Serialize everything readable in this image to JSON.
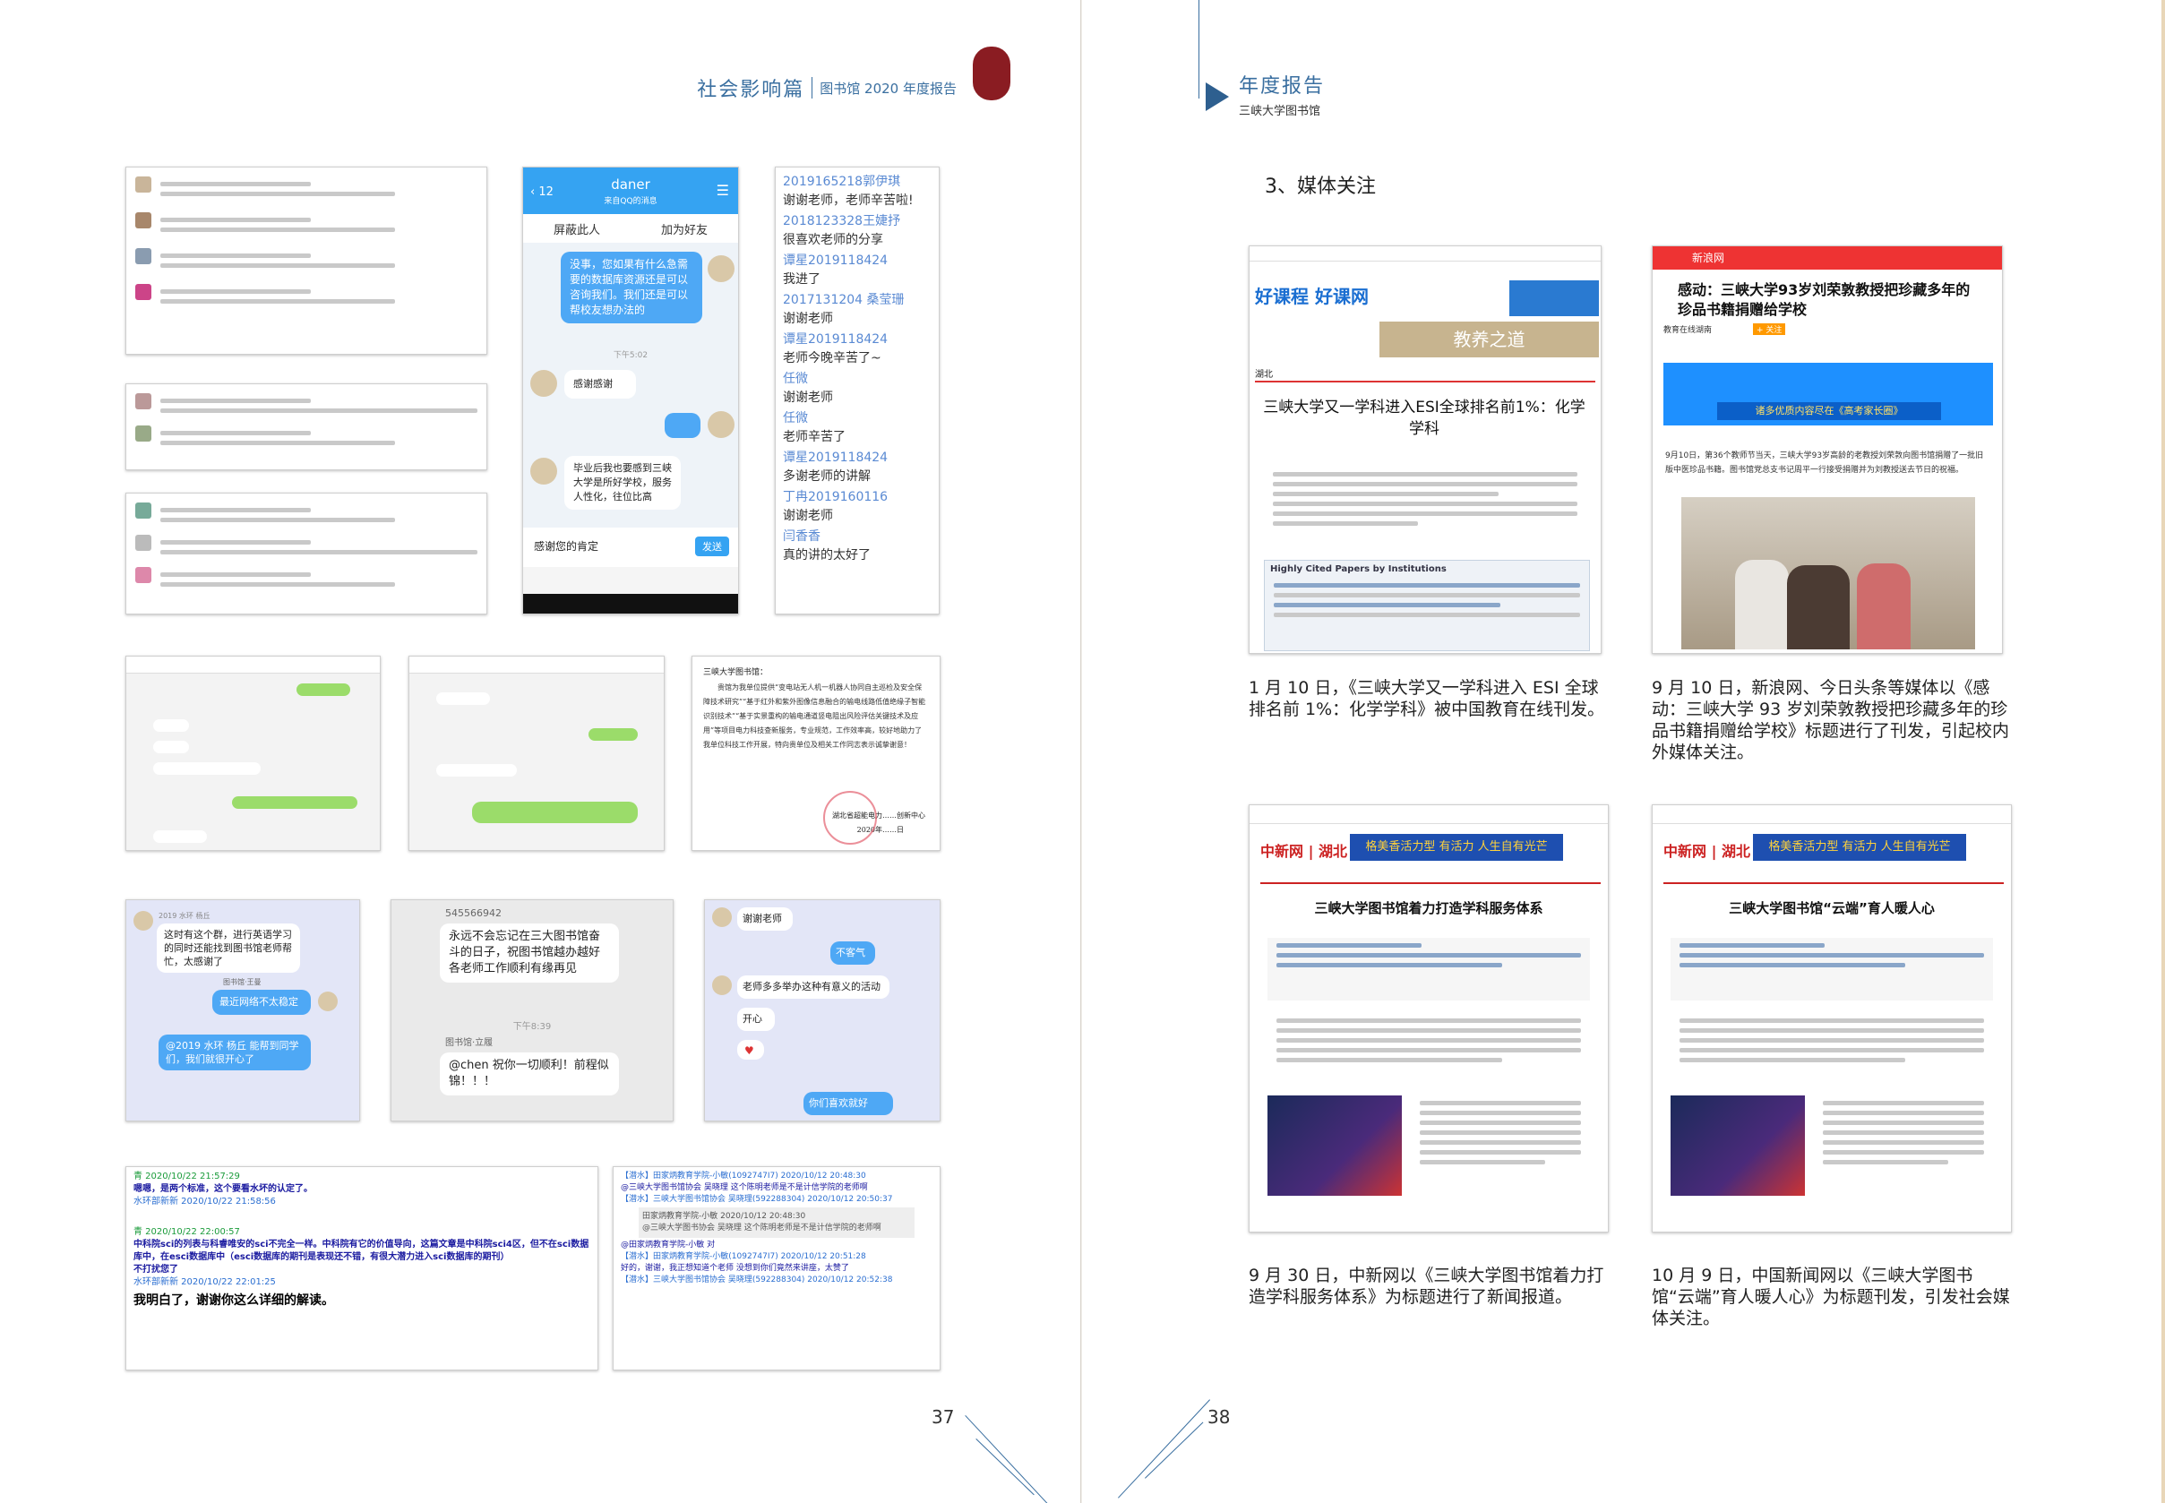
{
  "left_page": {
    "header": {
      "section": "社会影响篇",
      "subtitle": "图书馆 2020 年度报告"
    },
    "page_number": "37",
    "chat_qq": {
      "contact": "daner",
      "contact_sub": "来自QQ的消息",
      "back_count": "12",
      "block": "屏蔽此人",
      "add_friend": "加为好友",
      "msg1": "没事，您如果有什么急需要的数据库资源还是可以咨询我们。我们还是可以帮校友想办法的",
      "time": "下午5:02",
      "msg2": "感谢感谢",
      "msg3": "毕业后我也要感到三峡大学是所好学校，服务人性化，往位比高",
      "input": "感谢您的肯定",
      "send": "发送"
    },
    "thank_list": [
      {
        "name": "2019165218郭伊琪",
        "msg": "谢谢老师，老师辛苦啦!"
      },
      {
        "name": "2018123328王婕抒",
        "msg": "很喜欢老师的分享"
      },
      {
        "name": "谭星2019118424",
        "msg": "我进了"
      },
      {
        "name": "2017131204 桑莹珊",
        "msg": "谢谢老师"
      },
      {
        "name": "谭星2019118424",
        "msg": "老师今晚辛苦了~"
      },
      {
        "name": "任微",
        "msg": "谢谢老师"
      },
      {
        "name": "任微",
        "msg": "老师辛苦了"
      },
      {
        "name": "谭星2019118424",
        "msg": "多谢老师的讲解"
      },
      {
        "name": "丁冉2019160116",
        "msg": "谢谢老师"
      },
      {
        "name": "闫香香",
        "msg": "真的讲的太好了"
      }
    ],
    "chat_group1": {
      "time": "2019 水环 杨丘",
      "msg1": "这时有这个群，进行英语学习的同时还能找到图书馆老师帮忙，太感谢了",
      "tag": "图书馆·王曼",
      "msg2": "最近网络不太稳定",
      "msg3": "@2019 水环 杨丘 能帮到同学们，我们就很开心了"
    },
    "chat_group2": {
      "qq": "545566942",
      "msg1": "永远不会忘记在三大图书馆奋斗的日子，祝图书馆越办越好各老师工作顺利有缘再见",
      "time": "下午8:39",
      "tag": "图书馆·立履",
      "msg2": "@chen 祝你一切顺利！前程似锦！！！"
    },
    "chat_group3": {
      "msg1": "谢谢老师",
      "msg2": "不客气",
      "msg3": "老师多多举办这种有意义的活动",
      "msg4": "开心",
      "msg5": "你们喜欢就好"
    },
    "letter": {
      "to": "三峡大学图书馆：",
      "body": "贵馆为我单位提供“变电站无人机一机器人协同自主巡检及安全保障技术研究”“基于红外和紫外图像信息融合的输电线路低值绝缘子智能识别技术”“基于实景重构的输电通道竖电阻出风险评估关键技术及应用”等项目电力科技查新服务，专业规范，工作效率高，较好地助力了我单位科技工作开展，特向贵单位及相关工作同志表示诚挚谢意！",
      "sign": "湖北省超能电力……创新中心",
      "date": "2020年……日"
    },
    "forum": {
      "u1": "青 2020/10/22 21:57:29",
      "m1": "嗯嗯，是两个标准，这个要看水坏的认定了。",
      "u2": "水环部新新 2020/10/22 21:58:56",
      "u3": "青 2020/10/22 22:00:57",
      "m3": "中科院sci的列表与科睿唯安的sci不完全一样。中科院有它的价值导向，这篇文章是中科院sci4区，但不在sci数据库中，在esci数据库中（esci数据库的期刊是表现还不错，有很大潜力进入sci数据库的期刊）",
      "m3b": "不打扰您了",
      "u4": "水环部新新 2020/10/22 22:01:25",
      "m4": "我明白了，谢谢你这么详细的解读。"
    },
    "group_chat": {
      "r1": "【潜水】田家炳教育学院-小敏(1092747I7) 2020/10/12 20:48:30",
      "r1m": "@三峡大学图书馆协会 吴晓理 这个陈明老师是不是计信学院的老师啊",
      "r2": "【潜水】三峡大学图书馆协会 吴晓理(592288304) 2020/10/12 20:50:37",
      "q1": "田家炳教育学院-小敏 2020/10/12 20:48:30",
      "q1m": "@三峡大学图书协会 吴晓理 这个陈明老师是不是计信学院的老师啊",
      "r2m": "@田家炳教育学院-小敏 对",
      "r3": "【潜水】田家炳教育学院-小敏(1092747I7) 2020/10/12 20:51:28",
      "r3m": "好的，谢谢，我正想知道个老师 没想到你们竟然来讲座，太赞了",
      "r4": "【潜水】三峡大学图书馆协会 吴晓理(592288304) 2020/10/12 20:52:38"
    }
  },
  "right_page": {
    "header": {
      "title": "年度报告",
      "subtitle": "三峡大学图书馆"
    },
    "section_title": "3、媒体关注",
    "page_number": "38",
    "news": [
      {
        "site": "好课程 好课网",
        "region": "湖北",
        "headline": "三峡大学又一学科进入ESI全球排名前1%：化学学科",
        "banner2": "教养之道",
        "table_title": "Highly Cited Papers by Institutions",
        "caption": "1 月 10 日，《三峡大学又一学科进入 ESI 全球排名前 1%：化学学科》被中国教育在线刊发。"
      },
      {
        "site": "新浪网",
        "headline": "感动：三峡大学93岁刘荣敦教授把珍藏多年的珍品书籍捐赠给学校",
        "source": "教育在线湖南",
        "follow": "+ 关注",
        "banner": "诸多优质内容尽在《高考家长圈》",
        "body": "9月10日，第36个教师节当天，三峡大学93岁高龄的老教授刘荣敦向图书馆捐赠了一批旧版中医珍品书籍。图书馆党总支书记周平一行接受捐赠并为刘教授送去节日的祝福。",
        "caption": "9 月 10 日，新浪网、今日头条等媒体以《感动：三峡大学 93 岁刘荣敦教授把珍藏多年的珍品书籍捐赠给学校》标题进行了刊发，引起校内外媒体关注。"
      },
      {
        "site": "中新网 | 湖北",
        "headline": "三峡大学图书馆着力打造学科服务体系",
        "ad": "格美香活力型 有活力 人生自有光芒",
        "caption": "9 月 30 日，中新网以《三峡大学图书馆着力打造学科服务体系》为标题进行了新闻报道。"
      },
      {
        "site": "中新网 | 湖北",
        "headline": "三峡大学图书馆“云端”育人暖人心",
        "ad": "格美香活力型 有活力 人生自有光芒",
        "caption": "10 月 9 日，中国新闻网以《三峡大学图书馆“云端”育人暖人心》为标题刊发，引发社会媒体关注。"
      }
    ]
  }
}
